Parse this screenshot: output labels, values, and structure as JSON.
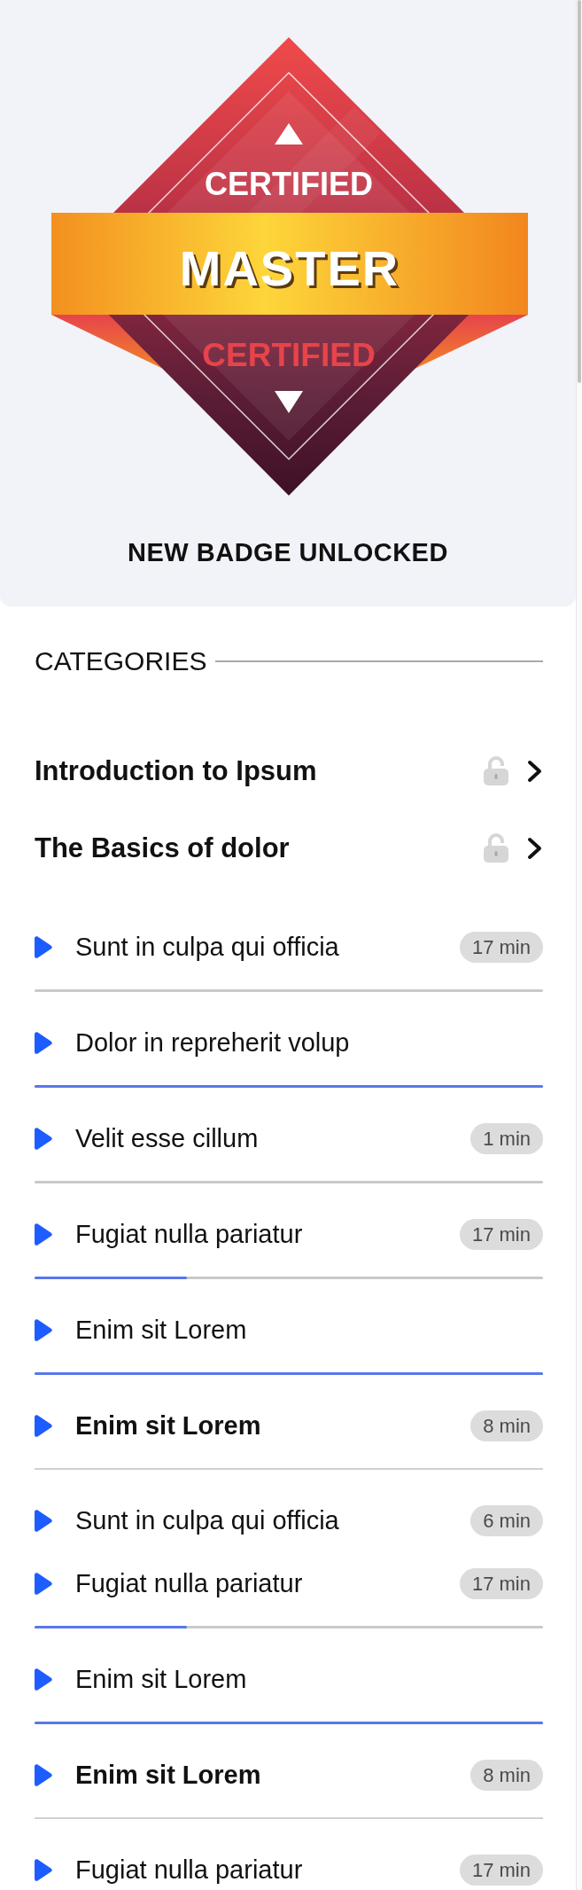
{
  "badge": {
    "top_label": "CERTIFIED",
    "title": "MASTER",
    "bottom_label": "CERTIFIED",
    "caption": "NEW BADGE UNLOCKED"
  },
  "categories": {
    "heading": "CATEGORIES",
    "items": [
      {
        "title": "Introduction to Ipsum",
        "locked": false
      },
      {
        "title": "The Basics of dolor",
        "locked": false
      }
    ]
  },
  "lessons": [
    {
      "title": "Sunt in culpa qui officia",
      "duration": "17 min",
      "active": false,
      "kind": "progress"
    },
    {
      "title": "Dolor in repreherit volup",
      "active": false,
      "kind": "progress",
      "level": 1
    },
    {
      "title": "Velit esse cillum",
      "duration": "1 min",
      "active": false,
      "kind": "progress"
    },
    {
      "title": "Fugiat nulla pariatur",
      "duration": "17 min",
      "active": false,
      "kind": "progress",
      "level": 0.3
    },
    {
      "title": "Enim sit Lorem",
      "active": false,
      "kind": "progress",
      "level": 1
    },
    {
      "title": "Enim sit Lorem",
      "duration": "8 min",
      "active": true,
      "kind": "divider"
    },
    {
      "title": "Sunt in culpa qui officia",
      "duration": "6 min",
      "active": false,
      "kind": "plain"
    },
    {
      "title": "Fugiat nulla pariatur",
      "duration": "17 min",
      "active": false,
      "kind": "progress",
      "level": 0.3
    },
    {
      "title": "Enim sit Lorem",
      "active": false,
      "kind": "progress",
      "level": 1
    },
    {
      "title": "Enim sit Lorem",
      "duration": "8 min",
      "active": true,
      "kind": "divider"
    },
    {
      "title": "Fugiat nulla pariatur",
      "duration": "17 min",
      "active": false,
      "kind": "plain"
    }
  ]
}
